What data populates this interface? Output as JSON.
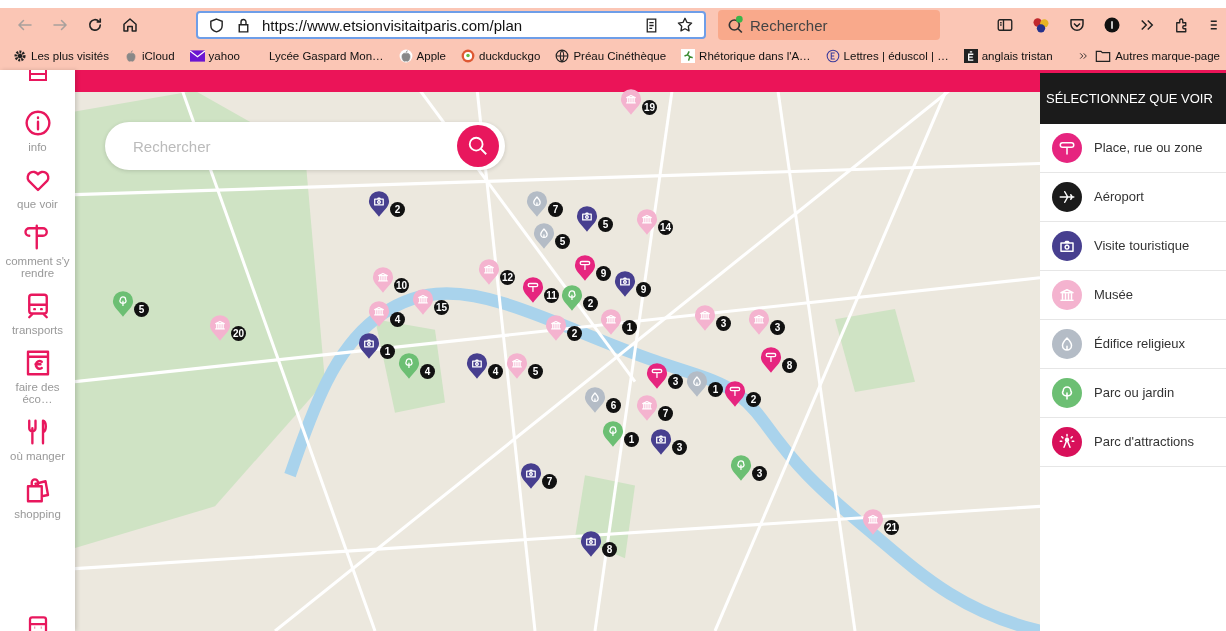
{
  "browser": {
    "address_bar": {
      "url": "https://www.etsionvisitaitparis.com/plan"
    },
    "search_bar": {
      "placeholder": "Rechercher"
    },
    "bookmarks": [
      {
        "kind": "gear",
        "label": "Les plus visités"
      },
      {
        "kind": "apple",
        "label": "iCloud"
      },
      {
        "kind": "mail",
        "label": "yahoo"
      },
      {
        "kind": "none",
        "label": "Lycée Gaspard Mon…"
      },
      {
        "kind": "apple",
        "label": "Apple"
      },
      {
        "kind": "duck",
        "label": "duckduckgo"
      },
      {
        "kind": "globe",
        "label": "Préau Cinéthèque"
      },
      {
        "kind": "image",
        "label": "Rhétorique dans l'A…"
      },
      {
        "kind": "circle-e",
        "label": "Lettres | éduscol | …"
      },
      {
        "kind": "square-e",
        "label": "anglais tristan"
      }
    ],
    "other_bookmarks": "Autres marque-page"
  },
  "sidebar": {
    "items": [
      {
        "kind": "info",
        "label": "info"
      },
      {
        "kind": "heart",
        "label": "que voir"
      },
      {
        "kind": "sign",
        "label": "comment s'y rendre"
      },
      {
        "kind": "train",
        "label": "transports"
      },
      {
        "kind": "wallet",
        "label": "faire des éco…"
      },
      {
        "kind": "food",
        "label": "où manger"
      },
      {
        "kind": "bag",
        "label": "shopping"
      }
    ]
  },
  "map": {
    "search": {
      "placeholder": "Rechercher"
    },
    "pins": [
      {
        "kind": "musee",
        "count": "19"
      },
      {
        "kind": "visite",
        "count": "2"
      },
      {
        "kind": "religieux",
        "count": "7"
      },
      {
        "kind": "visite",
        "count": "5"
      },
      {
        "kind": "musee",
        "count": "14"
      },
      {
        "kind": "religieux",
        "count": "5"
      },
      {
        "kind": "place",
        "count": "9"
      },
      {
        "kind": "musee",
        "count": "12"
      },
      {
        "kind": "place",
        "count": "11"
      },
      {
        "kind": "parc",
        "count": "5"
      },
      {
        "kind": "musee",
        "count": "10"
      },
      {
        "kind": "musee",
        "count": "15"
      },
      {
        "kind": "parc",
        "count": "2"
      },
      {
        "kind": "visite",
        "count": "9"
      },
      {
        "kind": "musee",
        "count": "1"
      },
      {
        "kind": "musee",
        "count": "2"
      },
      {
        "kind": "musee",
        "count": "20"
      },
      {
        "kind": "musee",
        "count": "4"
      },
      {
        "kind": "visite",
        "count": "1"
      },
      {
        "kind": "musee",
        "count": "3"
      },
      {
        "kind": "musee",
        "count": "3"
      },
      {
        "kind": "parc",
        "count": "4"
      },
      {
        "kind": "visite",
        "count": "4"
      },
      {
        "kind": "musee",
        "count": "5"
      },
      {
        "kind": "place",
        "count": "8"
      },
      {
        "kind": "place",
        "count": "3"
      },
      {
        "kind": "religieux",
        "count": "1"
      },
      {
        "kind": "place",
        "count": "2"
      },
      {
        "kind": "religieux",
        "count": "6"
      },
      {
        "kind": "musee",
        "count": "7"
      },
      {
        "kind": "parc",
        "count": "1"
      },
      {
        "kind": "visite",
        "count": "3"
      },
      {
        "kind": "parc",
        "count": "3"
      },
      {
        "kind": "visite",
        "count": "7"
      },
      {
        "kind": "musee",
        "count": "21"
      },
      {
        "kind": "visite",
        "count": "8"
      }
    ]
  },
  "panel": {
    "title": "SÉLECTIONNEZ QUE VOIR",
    "categories": [
      {
        "kind": "place",
        "label": "Place, rue ou zone",
        "color": "#e6257f"
      },
      {
        "kind": "aeroport",
        "label": "Aéroport",
        "color": "#1b1b1b"
      },
      {
        "kind": "visite",
        "label": "Visite touristique",
        "color": "#473f8f"
      },
      {
        "kind": "musee",
        "label": "Musée",
        "color": "#f4b3cf"
      },
      {
        "kind": "religieux",
        "label": "Édifice religieux",
        "color": "#b4bcc6"
      },
      {
        "kind": "parc",
        "label": "Parc ou jardin",
        "color": "#6cbf73"
      },
      {
        "kind": "attractions",
        "label": "Parc d'attractions",
        "color": "#d8105a"
      }
    ]
  }
}
